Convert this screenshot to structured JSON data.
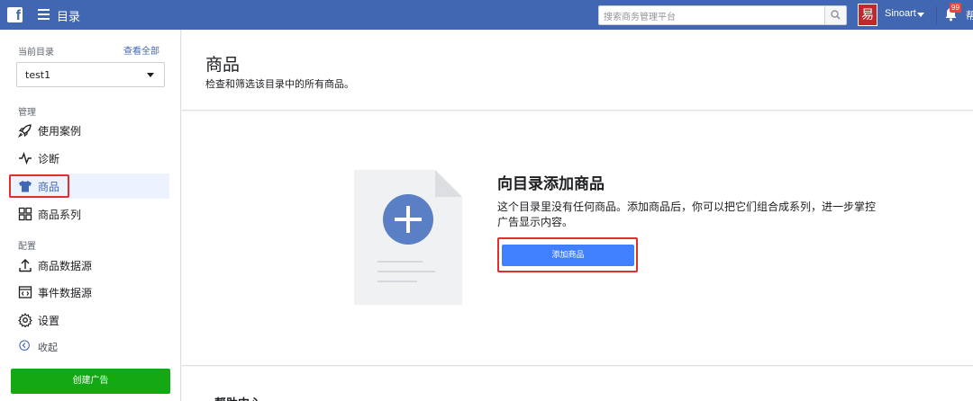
{
  "topbar": {
    "menu_title": "目录",
    "search_placeholder": "搜索商务管理平台",
    "user_name": "Sinoart",
    "avatar_char": "易",
    "notif_count": "99",
    "edge_text": "帮"
  },
  "sidebar": {
    "current_label": "当前目录",
    "view_all": "查看全部",
    "catalog_value": "test1",
    "section_manage": "管理",
    "section_config": "配置",
    "items": [
      {
        "label": "使用案例",
        "icon": "rocket-icon"
      },
      {
        "label": "诊断",
        "icon": "pulse-icon"
      },
      {
        "label": "商品",
        "icon": "shirt-icon",
        "active": true
      },
      {
        "label": "商品系列",
        "icon": "grid-icon"
      },
      {
        "label": "商品数据源",
        "icon": "upload-icon"
      },
      {
        "label": "事件数据源",
        "icon": "code-icon"
      },
      {
        "label": "设置",
        "icon": "gear-icon"
      }
    ],
    "collapse_label": "收起",
    "create_ad": "创建广告"
  },
  "main": {
    "title": "商品",
    "subtitle": "检查和筛选该目录中的所有商品。",
    "empty_title": "向目录添加商品",
    "empty_desc": "这个目录里没有任何商品。添加商品后，你可以把它们组合成系列，进一步掌控广告显示内容。",
    "add_button": "添加商品",
    "help_title": "帮助中心"
  },
  "colors": {
    "brand": "#4267b2",
    "primary_button": "#4080ff",
    "create_ad": "#14a814",
    "highlight": "#e02f2f",
    "notif": "#fa3e3e"
  }
}
